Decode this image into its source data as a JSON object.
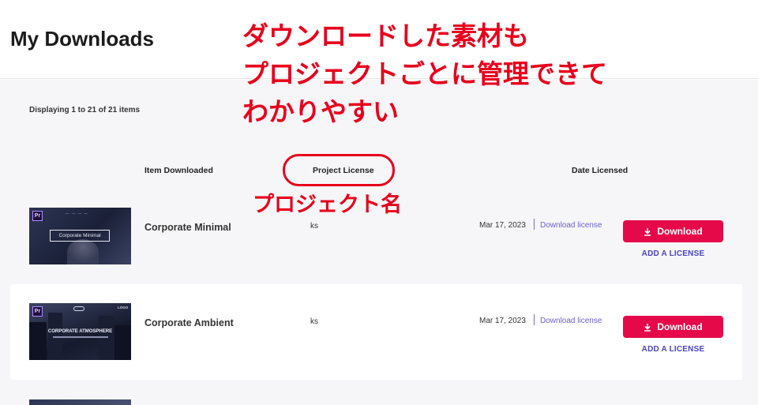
{
  "header": {
    "title": "My Downloads"
  },
  "summary": {
    "displaying": "Displaying 1 to 21 of 21 items"
  },
  "columns": {
    "item": "Item Downloaded",
    "project": "Project License",
    "date": "Date Licensed"
  },
  "rows": [
    {
      "thumb_badge": "Pr",
      "thumb_caption": "Corporate Minimal",
      "item": "Corporate Minimal",
      "project": "ks",
      "date": "Mar 17, 2023",
      "license_link": "Download license",
      "download_label": "Download",
      "add_license_label": "ADD A LICENSE"
    },
    {
      "thumb_badge": "Pr",
      "thumb_caption": "CORPORATE ATMOSPHERE",
      "thumb_logo": "LOGO",
      "item": "Corporate Ambient",
      "project": "ks",
      "date": "Mar 17, 2023",
      "license_link": "Download license",
      "download_label": "Download",
      "add_license_label": "ADD A LICENSE"
    }
  ],
  "annotations": {
    "main_lines": [
      "ダウンロードした素材も",
      "プロジェクトごとに管理できて",
      "わかりやすい"
    ],
    "project_note": "プロジェクト名"
  },
  "colors": {
    "accent_button": "#e5094a",
    "link": "#6b5fd6",
    "annotation": "#e8001c"
  },
  "icons": [
    "download-icon"
  ]
}
